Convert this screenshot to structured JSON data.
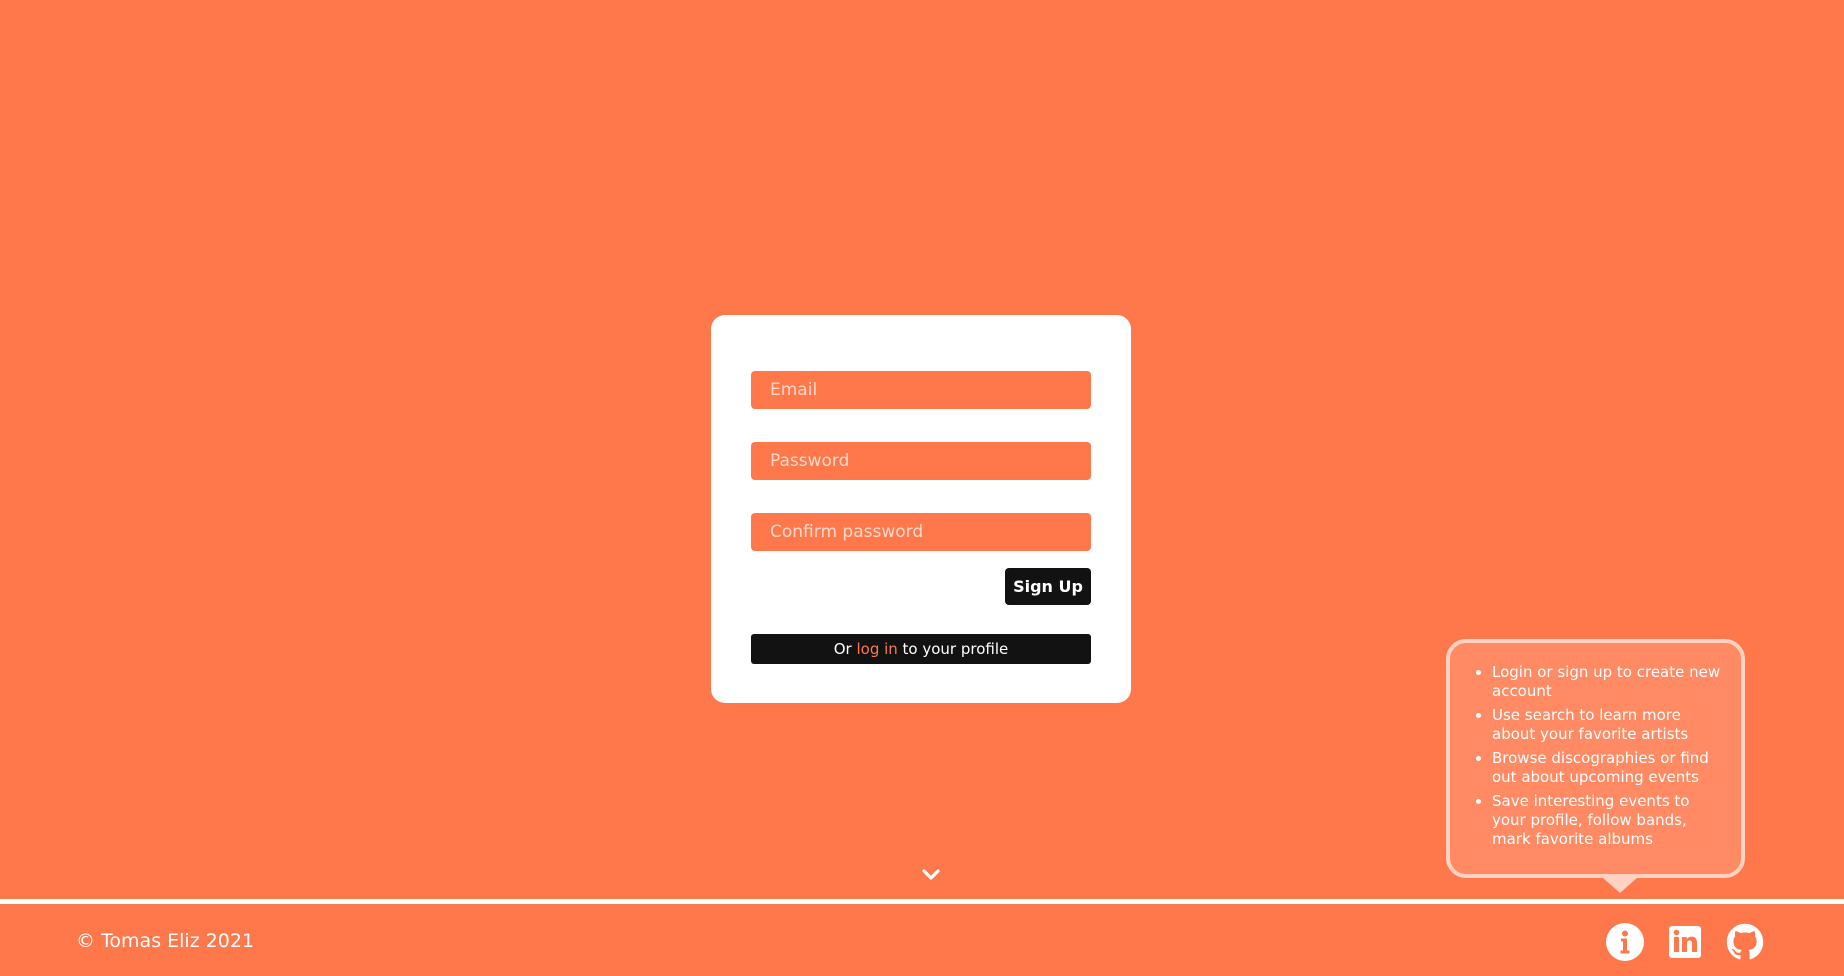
{
  "signup_form": {
    "email_placeholder": "Email",
    "password_placeholder": "Password",
    "confirm_placeholder": "Confirm password",
    "submit_label": "Sign Up",
    "login_prefix": "Or ",
    "login_link": "log in",
    "login_suffix": " to your profile"
  },
  "info_bubble": {
    "items": [
      "Login or sign up to create new account",
      "Use search to learn more about your favorite artists",
      "Browse discographies or find out about upcoming events",
      "Save interesting events to your profile, follow bands, mark favorite albums"
    ]
  },
  "footer": {
    "copyright": "© Tomas Eliz 2021",
    "icons": [
      "info-icon",
      "linkedin-icon",
      "github-icon",
      "chevron-down-icon"
    ]
  },
  "colors": {
    "background": "#ff784b",
    "card": "#ffffff",
    "dark": "#121212",
    "bubble_fill": "#ff8a63",
    "bubble_border": "#ffd2c2"
  }
}
